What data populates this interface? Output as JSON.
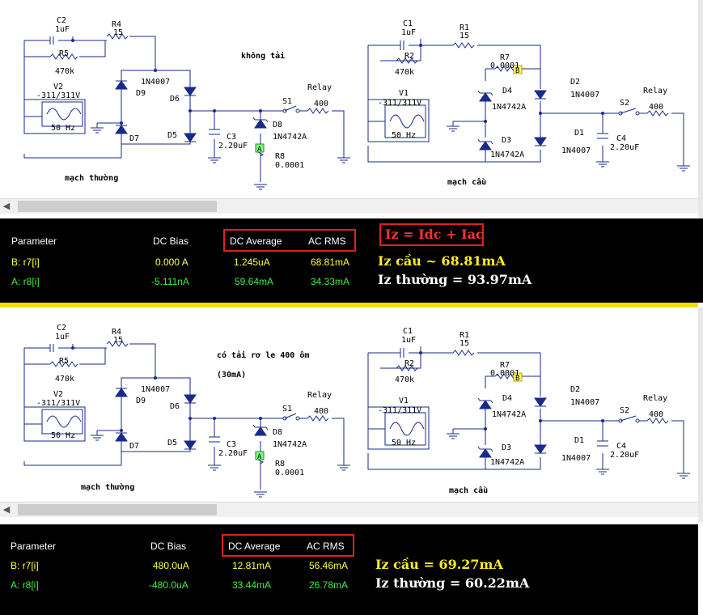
{
  "top": {
    "left_title": "mạch thường",
    "right_title": "mạch cầu",
    "condition_label": "không tải",
    "labels": {
      "c2": "C2",
      "c2v": "1uF",
      "r5": "R5",
      "r5v": "470k",
      "r4": "R4",
      "r4v": "15",
      "v2": "V2",
      "v2v": "-311/311V",
      "v2f": "50 Hz",
      "d9": "D9",
      "d7": "D7",
      "d6": "D6",
      "d5": "D5",
      "d6model": "1N4007",
      "c3": "C3",
      "c3v": "2.20uF",
      "d8": "D8",
      "d8model": "1N4742A",
      "r8": "R8",
      "r8v": "0.0001",
      "s1": "S1",
      "relay_l": "Relay",
      "relay_lv": "400",
      "probe_a": "A",
      "c1": "C1",
      "c1v": "1uF",
      "r1": "R1",
      "r1v": "15",
      "r2": "R2",
      "r2v": "470k",
      "r7": "R7",
      "r7v": "0.0001",
      "probe_b": "B",
      "v1": "V1",
      "v1v": "-311/311V",
      "v1f": "50 Hz",
      "d4": "D4",
      "d4model": "1N4742A",
      "d3": "D3",
      "d3model": "1N4742A",
      "d2": "D2",
      "d2model": "1N4007",
      "d1": "D1",
      "d1model": "1N4007",
      "c4": "C4",
      "c4v": "2.20uF",
      "s2": "S2",
      "relay_r": "Relay",
      "relay_rv": "400"
    },
    "table": {
      "headers": [
        "Parameter",
        "DC Bias",
        "DC Average",
        "AC RMS"
      ],
      "rows": [
        {
          "param": "B: r7[i]",
          "dc_bias": "0.000 A",
          "dc_avg": "1.245uA",
          "ac_rms": "68.81mA"
        },
        {
          "param": "A: r8[i]",
          "dc_bias": "-5.111nA",
          "dc_avg": "59.64mA",
          "ac_rms": "34.33mA"
        }
      ],
      "formula": "Iz = Idc + Iac",
      "note_bridge": "Iz cầu ~ 68.81mA",
      "note_normal": "Iz thường = 93.97mA"
    }
  },
  "bottom": {
    "left_title": "mạch thường",
    "right_title": "mạch cầu",
    "condition_label_1": "có tải rơ le 400 ôm",
    "condition_label_2": "(30mA)",
    "table": {
      "headers": [
        "Parameter",
        "DC Bias",
        "DC Average",
        "AC RMS"
      ],
      "rows": [
        {
          "param": "B: r7[i]",
          "dc_bias": "480.0uA",
          "dc_avg": "12.81mA",
          "ac_rms": "56.46mA"
        },
        {
          "param": "A: r8[i]",
          "dc_bias": "-480.0uA",
          "dc_avg": "33.44mA",
          "ac_rms": "26.78mA"
        }
      ],
      "note_bridge": "Iz cầu = 69.27mA",
      "note_normal": "Iz thường = 60.22mA"
    }
  },
  "colors": {
    "wire": "#1a2a8a",
    "panel_bg": "#000000",
    "row_b": "#ffff44",
    "row_a": "#44ee44",
    "highlight": "#e02020",
    "divider": "#f0e000"
  }
}
